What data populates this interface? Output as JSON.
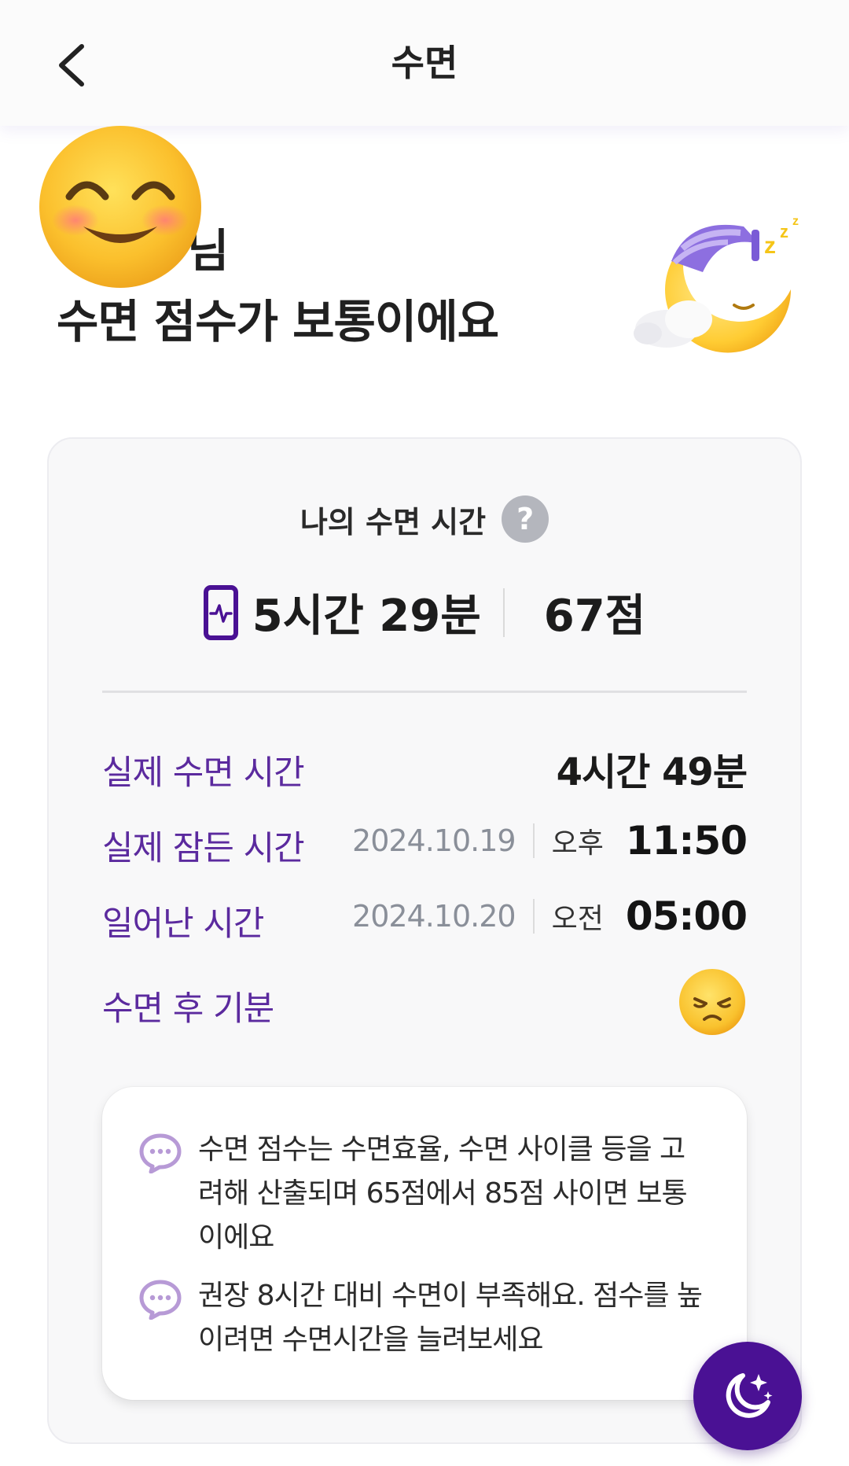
{
  "header": {
    "title": "수면",
    "back_icon": "chevron-left-icon"
  },
  "greeting": {
    "name_suffix": "님",
    "headline": "수면 점수가 보통이에요",
    "avatar_icon": "smiling-face-emoji",
    "illustration_icon": "sleeping-moon-icon"
  },
  "card": {
    "title": "나의 수면 시간",
    "help_icon": "question-icon",
    "help_label": "?",
    "summary": {
      "device_icon": "phone-heartbeat-icon",
      "duration": "5시간 29분",
      "score": "67점"
    },
    "rows": {
      "actual_sleep": {
        "label": "실제 수면 시간",
        "value": "4시간 49분"
      },
      "fell_asleep": {
        "label": "실제 잠든 시간",
        "date": "2024.10.19",
        "ampm": "오후",
        "time": "11:50"
      },
      "woke_up": {
        "label": "일어난 시간",
        "date": "2024.10.20",
        "ampm": "오전",
        "time": "05:00"
      },
      "mood": {
        "label": "수면 후 기분",
        "icon": "tired-face-icon"
      }
    },
    "tips": [
      {
        "icon": "chat-bubble-icon",
        "text": "수면 점수는 수면효율, 수면 사이클 등을 고려해 산출되며 65점에서 85점 사이면 보통이에요"
      },
      {
        "icon": "chat-bubble-icon",
        "text": "권장 8시간 대비 수면이 부족해요. 점수를 높이려면 수면시간을 늘려보세요"
      }
    ]
  },
  "fab": {
    "icon": "moon-stars-icon"
  },
  "colors": {
    "accent": "#5b2a9e",
    "fab": "#4a1194",
    "tip_icon": "#b79ad6"
  }
}
